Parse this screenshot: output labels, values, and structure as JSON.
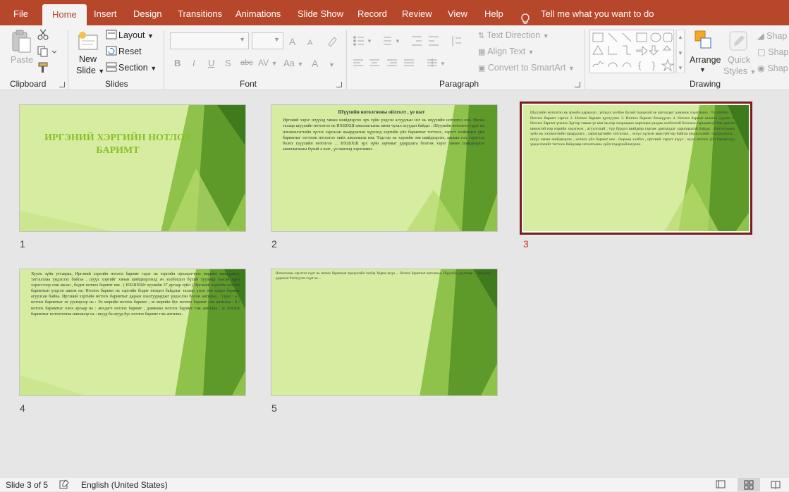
{
  "tabs": [
    "File",
    "Home",
    "Insert",
    "Design",
    "Transitions",
    "Animations",
    "Slide Show",
    "Record",
    "Review",
    "View",
    "Help"
  ],
  "tell_me": "Tell me what you want to do",
  "ribbon": {
    "clipboard": {
      "label": "Clipboard",
      "paste": "Paste"
    },
    "slides": {
      "label": "Slides",
      "new_slide_1": "New",
      "new_slide_2": "Slide",
      "layout": "Layout",
      "reset": "Reset",
      "section": "Section"
    },
    "font": {
      "label": "Font",
      "bold": "B",
      "italic": "I",
      "underline": "U",
      "shadow": "S",
      "strike": "abc",
      "spacing": "AV",
      "case": "Aa"
    },
    "paragraph": {
      "label": "Paragraph",
      "text_direction": "Text Direction",
      "align_text": "Align Text",
      "smartart": "Convert to SmartArt"
    },
    "drawing": {
      "label": "Drawing",
      "arrange": "Arrange",
      "quick_styles_1": "Quick",
      "quick_styles_2": "Styles",
      "shape_fill": "Shap",
      "shape_outline": "Shap",
      "shape_effects": "Shap"
    }
  },
  "slides": [
    {
      "number": "1",
      "title": "ИРГЭНИЙ ХЭРГИЙН НОТЛОХ БАРИМТ"
    },
    {
      "number": "2",
      "title": "Шүүхийн нотолгооны ойлголт , үе шат",
      "body": "Иргэний хэрэг шүүхэд хянан шийдвэрлэх эрх зүйн үндсэн асуудлын нэг нь шүүхийн нотолгоо юм. Нөгөө талаар шүүхийн нотолгоо нь ИХШХШ ажиллагааны амин чухал асуудал байдаг . Шүүхийн нотолгоо гэдэг нь нэхэмжлэгчийн зүгээс гаргасан шаардлагын хүрээнд хэргийн үйл баримтыг тогтоох, хэрэгт холбогдох үйл баримтыг тогтоож нотолгоо хийх ажиллагаа юм. Тэдгээр нь хэргийн зөв шийдвэрлэх, ажлын гол хэрэгсэл болох шүүхийн нотолгоо ... ИХШХШ эрх зүйн зарчмыг удирдлага болгож хэрэг хянан шийдвэрлэх ажиллагааны бүхий л шат , үе шатанд хэрэгжинэ ."
    },
    {
      "number": "3",
      "body": "Шүүхийн нотолгоо нь эрэмбэ дараалал , үйлдэл холбоо бүхий тодорхой үе шатуудыг дамжиж хэрэгжинэ . Тухайлбал , 1. Нотлох баримт гаргах 2. Нотлох баримт цуглуулах 3. Нотлох баримт бэхжүүлэх 4. Нотлох баримт шалгах судлах 5. Нотлох баримт үнэлэх Эдгээр тавын үе шат нь нэр хоорондоо харилцан уялдаа холбоотой болохоо харьцангуй бие даасан шинжтэй нэр нэрийн хэрэгжих , агуулгатай , түр бүрдэл шийдвэр гаргаж давтагддаг харилцаатай байдаг . Нотолгооны зүйл нь хэлзмэгчийн шаардлага , хариуцагчийн татгалзал , эсхүл хүлээн авахгүйгээр байгаа үндэслэлийг тодорхойлох , шүүх хянан шийдвэрлэх , нотлох үйл баримт юм . Өөрөөр хэлбэл , иргэний хэрэгт шүүх , нууц нотлох үйл баримтууд үндэслэлийг тогтоох байдлаар нотолгооны зүйл тодорхойлогдоно ."
    },
    {
      "number": "4",
      "body": "Хуулъ зүйн утгаараа, Иргэний хэргийн нотлох баримт гэдэг нь хэргийн оролцогчоос өөрийн шаардлага, татгалзлаа үндэслэх байгаа , шүүх хэргийг хянан шийдвэрлэхэд ач холбогдол бүхий хуулиар заасан арга хэрэгслээр олж авсан , бодит нотлох баримт юм . ( ИХШХШт хуулийн 37 дугаар зүйл ) Иргэний хэргийн нотлох баримтын үндсэн шинж нь: Нотлох баримт нь хэргийн бодит нөхцөл байдлыг талаар үнэн зөв мэдээ баримт агуулсан байна. Иргэний хэргийн нотлох баримтыг дараах шалгуураудыг үндэслэн болон ангилна . Үүнд : а / нотлох баримтыг эх үүсвэрээр нь : Эх мөрийн нотлох баримт ; эх мөрийн бус нотлох баримт гэж ангилна . б / нотлох баримтыг олох аргаар нь : анхдагч нотлох баримт , дамжмал нотлох баримт гэж ангилна . в/ нотлох баримтыг нотолгооны шинжээр нь : шууд ба шууд бус нотлох баримт гэж ангилна ."
    },
    {
      "number": "5",
      "body": "Нотолгооны хэрэгсэл гэдэг нь нотлох баримтын процессийн хэлбэр Хариж шүүх ... Нотлох баримтыг ангилахад. Шүүхийн дадлагаар ... Шүүхийн дадлагыг бэлтгүүлэх гэдэг нь ..."
    }
  ],
  "status": {
    "slide": "Slide 3 of 5",
    "language": "English (United States)"
  },
  "colors": {
    "accent": "#b7472a",
    "selected_slide_border": "#7a1f1f",
    "slide_title": "#8bbf2a"
  }
}
